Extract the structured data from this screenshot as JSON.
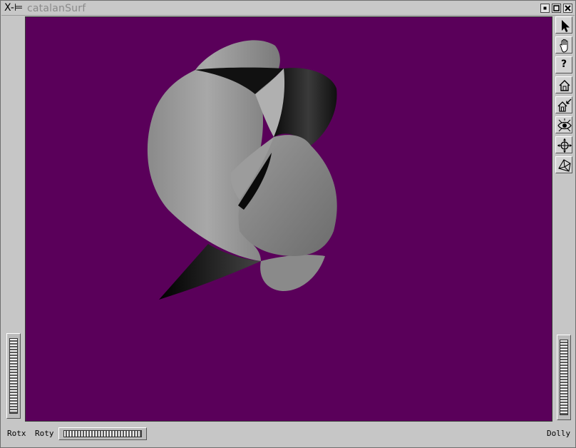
{
  "window": {
    "title": "catalanSurf",
    "title_glyph": "X-⊨"
  },
  "viewer": {
    "background_color": "#5a005a",
    "content": "catalan-surface-3d-render"
  },
  "toolbar": {
    "items": [
      {
        "name": "select-tool",
        "icon": "arrow-pointer-icon"
      },
      {
        "name": "view-tool",
        "icon": "hand-icon"
      },
      {
        "name": "help",
        "icon": "question-mark-icon",
        "label": "?"
      },
      {
        "name": "home",
        "icon": "home-icon"
      },
      {
        "name": "set-home",
        "icon": "set-home-icon"
      },
      {
        "name": "view-all",
        "icon": "eye-icon"
      },
      {
        "name": "seek",
        "icon": "target-crosshair-icon"
      },
      {
        "name": "perspective",
        "icon": "perspective-cube-icon"
      }
    ]
  },
  "bottom": {
    "rotx_label": "Rotx",
    "roty_label": "Roty",
    "dolly_label": "Dolly"
  },
  "colors": {
    "chrome": "#c6c6c6",
    "viewer_bg": "#5a005a"
  }
}
